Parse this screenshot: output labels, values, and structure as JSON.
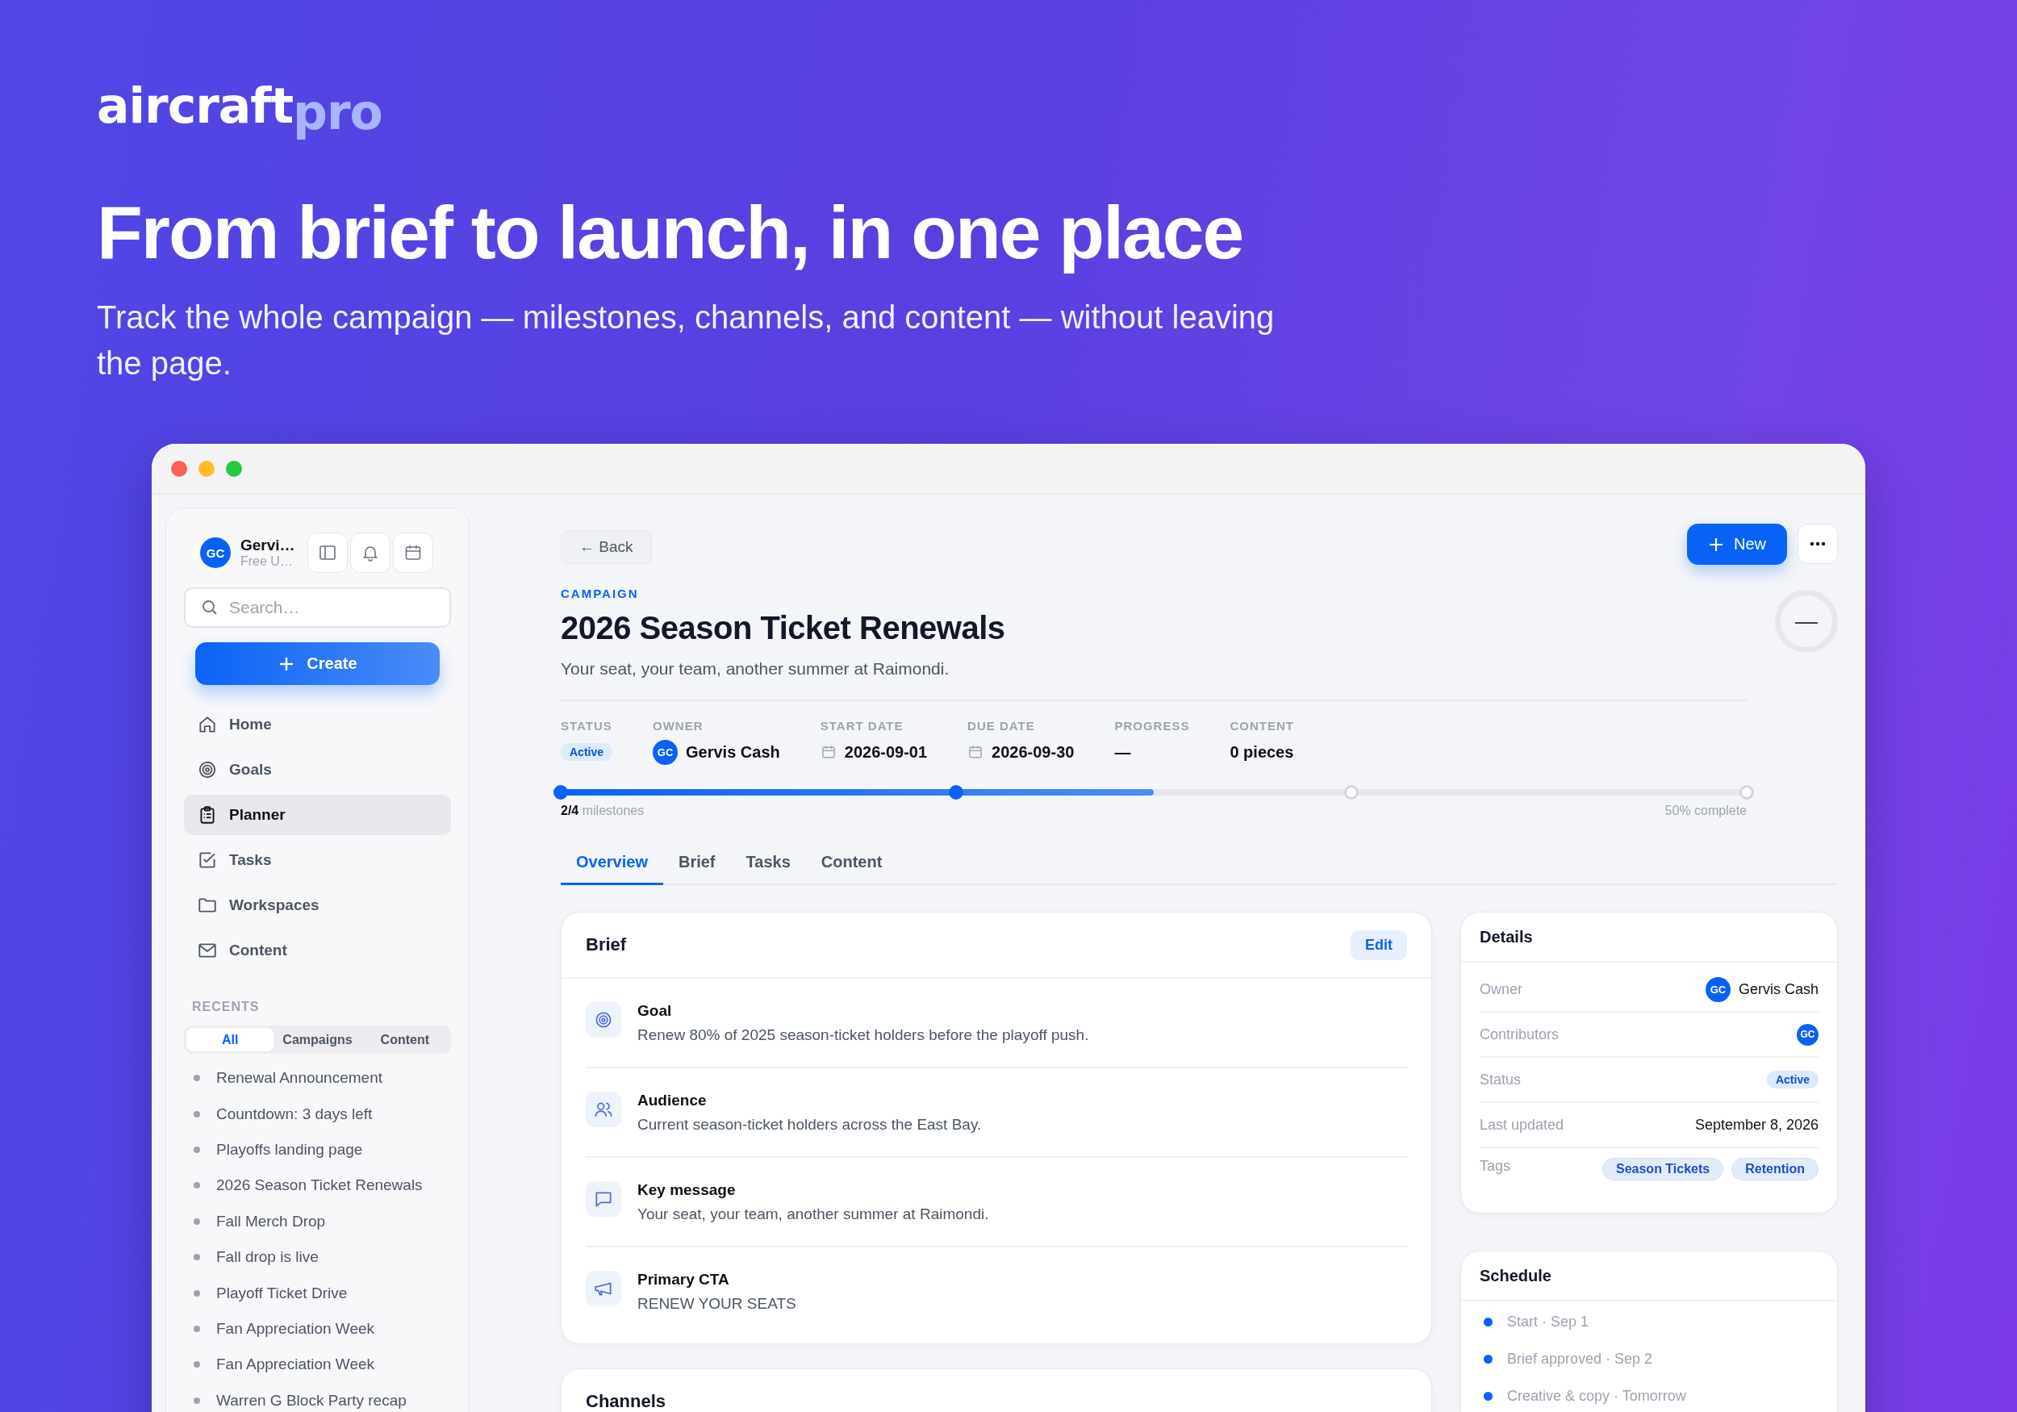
{
  "brand": {
    "name": "aircraft",
    "suffix": "pro"
  },
  "hero": {
    "headline": "From brief to launch, in one place",
    "subtitle": "Track the whole campaign — milestones, channels, and content — without leaving the page."
  },
  "sidebar": {
    "user": {
      "initials": "GC",
      "name": "Gervi…",
      "plan": "Free U…"
    },
    "search": {
      "placeholder": "Search…"
    },
    "create_label": "Create",
    "nav": [
      {
        "label": "Home",
        "selected": false
      },
      {
        "label": "Goals",
        "selected": false
      },
      {
        "label": "Planner",
        "selected": true
      },
      {
        "label": "Tasks",
        "selected": false
      },
      {
        "label": "Workspaces",
        "selected": false
      },
      {
        "label": "Content",
        "selected": false
      }
    ],
    "recents": {
      "title": "RECENTS",
      "filters": [
        {
          "label": "All",
          "selected": true
        },
        {
          "label": "Campaigns",
          "selected": false
        },
        {
          "label": "Content",
          "selected": false
        }
      ],
      "items": [
        "Renewal Announcement",
        "Countdown: 3 days left",
        "Playoffs landing page",
        "2026 Season Ticket Renewals",
        "Fall Merch Drop",
        "Fall drop is live",
        "Playoff Ticket Drive",
        "Fan Appreciation Week",
        "Fan Appreciation Week",
        "Warren G Block Party recap"
      ]
    }
  },
  "header": {
    "back_label": "← Back",
    "new_label": "New",
    "eyebrow": "CAMPAIGN",
    "title": "2026 Season Ticket Renewals",
    "subtitle": "Your seat, your team, another summer at Raimondi.",
    "ring_text": "—"
  },
  "meta": [
    {
      "label": "STATUS",
      "kind": "badge",
      "value": "Active"
    },
    {
      "label": "OWNER",
      "kind": "person",
      "initials": "GC",
      "value": "Gervis Cash"
    },
    {
      "label": "START DATE",
      "kind": "date",
      "value": "2026-09-01"
    },
    {
      "label": "DUE DATE",
      "kind": "date",
      "value": "2026-09-30"
    },
    {
      "label": "PROGRESS",
      "kind": "text",
      "value": "—"
    },
    {
      "label": "CONTENT",
      "kind": "text",
      "value": "0 pieces"
    }
  ],
  "progress": {
    "level": 0.5,
    "milestones": [
      {
        "done": true
      },
      {
        "done": true
      },
      {
        "done": false
      },
      {
        "done": false
      }
    ],
    "count": "2/4",
    "count_label": "milestones",
    "percent_label": "50% complete"
  },
  "tabs": [
    {
      "label": "Overview",
      "selected": true
    },
    {
      "label": "Brief",
      "selected": false
    },
    {
      "label": "Tasks",
      "selected": false
    },
    {
      "label": "Content",
      "selected": false
    }
  ],
  "brief": {
    "title": "Brief",
    "edit_label": "Edit",
    "items": [
      {
        "label": "Goal",
        "text": "Renew 80% of 2025 season-ticket holders before the playoff push."
      },
      {
        "label": "Audience",
        "text": "Current season-ticket holders across the East Bay."
      },
      {
        "label": "Key message",
        "text": "Your seat, your team, another summer at Raimondi."
      },
      {
        "label": "Primary CTA",
        "text": "RENEW YOUR SEATS"
      }
    ]
  },
  "channels": {
    "title": "Channels"
  },
  "details": {
    "title": "Details",
    "rows": [
      {
        "label": "Owner",
        "kind": "person",
        "initials": "GC",
        "value": "Gervis Cash"
      },
      {
        "label": "Contributors",
        "kind": "avatars",
        "initials": [
          "GC"
        ]
      },
      {
        "label": "Status",
        "kind": "badge",
        "value": "Active"
      },
      {
        "label": "Last updated",
        "kind": "text",
        "value": "September 8, 2026"
      },
      {
        "label": "Tags",
        "kind": "tags",
        "tags": [
          "Season Tickets",
          "Retention"
        ]
      }
    ]
  },
  "schedule": {
    "title": "Schedule",
    "items": [
      "Start · Sep 1",
      "Brief approved · Sep 2",
      "Creative & copy · Tomorrow"
    ]
  }
}
